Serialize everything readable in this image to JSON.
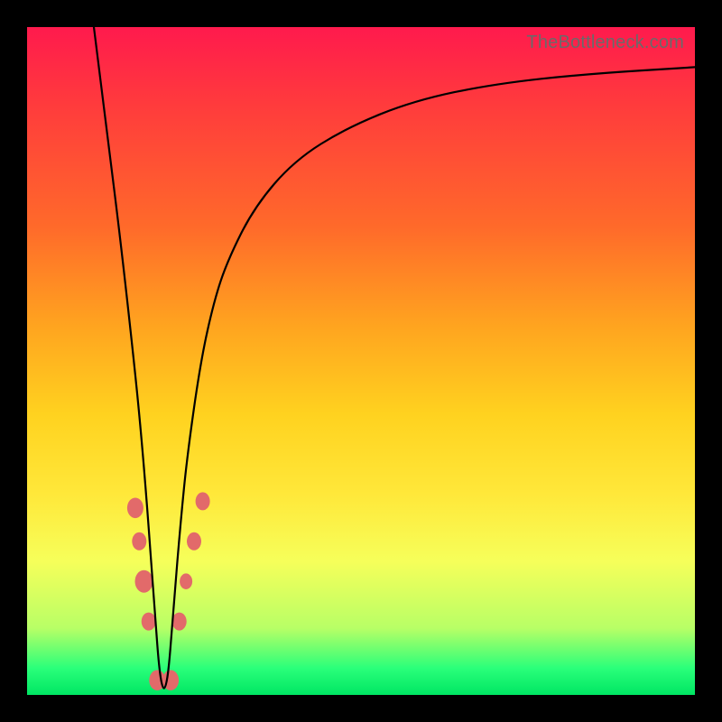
{
  "attribution": "TheBottleneck.com",
  "chart_data": {
    "type": "line",
    "title": "",
    "xlabel": "",
    "ylabel": "",
    "xlim": [
      0,
      100
    ],
    "ylim": [
      0,
      100
    ],
    "grid": false,
    "series": [
      {
        "name": "curve",
        "color": "#000000",
        "x": [
          10,
          12,
          14,
          16,
          17,
          18,
          19,
          20,
          21,
          22,
          23,
          24,
          26,
          28,
          30,
          34,
          40,
          48,
          58,
          70,
          84,
          100
        ],
        "y": [
          100,
          84,
          68,
          50,
          40,
          28,
          14,
          1,
          1,
          14,
          26,
          36,
          50,
          59,
          65,
          73,
          80,
          85,
          89,
          91.5,
          93,
          94
        ]
      }
    ],
    "markers": [
      {
        "name": "left-cluster",
        "color": "#e26a6a",
        "shape": "blob",
        "points": [
          {
            "x": 16.2,
            "y": 28,
            "r": 9
          },
          {
            "x": 16.8,
            "y": 23,
            "r": 8
          },
          {
            "x": 17.5,
            "y": 17,
            "r": 10
          },
          {
            "x": 18.2,
            "y": 11,
            "r": 8
          }
        ]
      },
      {
        "name": "bottom-cluster",
        "color": "#e26a6a",
        "shape": "blob",
        "points": [
          {
            "x": 19.5,
            "y": 2.2,
            "r": 9
          },
          {
            "x": 21.5,
            "y": 2.2,
            "r": 9
          }
        ]
      },
      {
        "name": "right-cluster",
        "color": "#e26a6a",
        "shape": "blob",
        "points": [
          {
            "x": 22.8,
            "y": 11,
            "r": 8
          },
          {
            "x": 23.8,
            "y": 17,
            "r": 7
          },
          {
            "x": 25.0,
            "y": 23,
            "r": 8
          },
          {
            "x": 26.3,
            "y": 29,
            "r": 8
          }
        ]
      }
    ]
  }
}
